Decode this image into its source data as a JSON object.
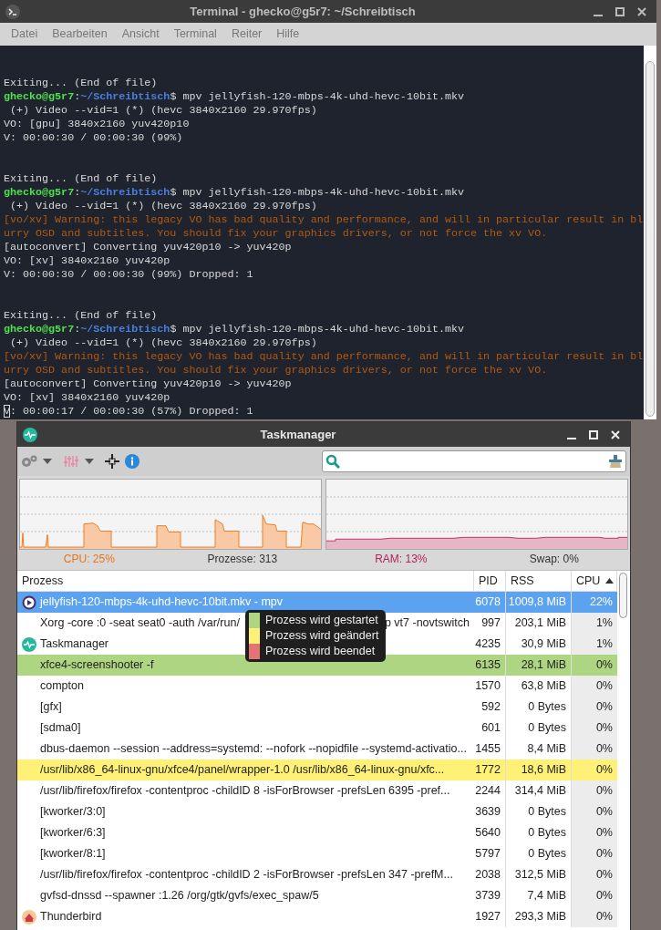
{
  "terminal": {
    "title": "Terminal - ghecko@g5r7: ~/Schreibtisch",
    "menu": [
      "Datei",
      "Bearbeiten",
      "Ansicht",
      "Terminal",
      "Reiter",
      "Hilfe"
    ],
    "lines": [
      {
        "kind": "blank"
      },
      {
        "kind": "blank"
      },
      {
        "kind": "text",
        "segments": [
          {
            "kind": "plain",
            "text": "Exiting... (End of file)"
          }
        ]
      },
      {
        "kind": "text",
        "segments": [
          {
            "kind": "user",
            "text": "ghecko@g5r7"
          },
          {
            "kind": "plain",
            "text": ":"
          },
          {
            "kind": "path",
            "text": "~/Schreibtisch"
          },
          {
            "kind": "plain",
            "text": "$ mpv jellyfish-120-mbps-4k-uhd-hevc-10bit.mkv"
          }
        ]
      },
      {
        "kind": "text",
        "segments": [
          {
            "kind": "plain",
            "text": " (+) Video --vid=1 (*) (hevc 3840x2160 29.970fps)"
          }
        ]
      },
      {
        "kind": "text",
        "segments": [
          {
            "kind": "plain",
            "text": "VO: [gpu] 3840x2160 yuv420p10"
          }
        ]
      },
      {
        "kind": "text",
        "segments": [
          {
            "kind": "plain",
            "text": "V: 00:00:30 / 00:00:30 (99%)"
          }
        ]
      },
      {
        "kind": "blank"
      },
      {
        "kind": "blank"
      },
      {
        "kind": "text",
        "segments": [
          {
            "kind": "plain",
            "text": "Exiting... (End of file)"
          }
        ]
      },
      {
        "kind": "text",
        "segments": [
          {
            "kind": "user",
            "text": "ghecko@g5r7"
          },
          {
            "kind": "plain",
            "text": ":"
          },
          {
            "kind": "path",
            "text": "~/Schreibtisch"
          },
          {
            "kind": "plain",
            "text": "$ mpv jellyfish-120-mbps-4k-uhd-hevc-10bit.mkv"
          }
        ]
      },
      {
        "kind": "text",
        "segments": [
          {
            "kind": "plain",
            "text": " (+) Video --vid=1 (*) (hevc 3840x2160 29.970fps)"
          }
        ]
      },
      {
        "kind": "text",
        "segments": [
          {
            "kind": "warning",
            "text": "[vo/xv] Warning: this legacy VO has bad quality and performance, and will in particular result in bl"
          }
        ]
      },
      {
        "kind": "text",
        "segments": [
          {
            "kind": "warning",
            "text": "urry OSD and subtitles. You should fix your graphics drivers, or not force the xv VO."
          }
        ]
      },
      {
        "kind": "text",
        "segments": [
          {
            "kind": "plain",
            "text": "[autoconvert] Converting yuv420p10 -> yuv420p"
          }
        ]
      },
      {
        "kind": "text",
        "segments": [
          {
            "kind": "plain",
            "text": "VO: [xv] 3840x2160 yuv420p"
          }
        ]
      },
      {
        "kind": "text",
        "segments": [
          {
            "kind": "plain",
            "text": "V: 00:00:30 / 00:00:30 (99%) Dropped: 1"
          }
        ]
      },
      {
        "kind": "blank"
      },
      {
        "kind": "blank"
      },
      {
        "kind": "text",
        "segments": [
          {
            "kind": "plain",
            "text": "Exiting... (End of file)"
          }
        ]
      },
      {
        "kind": "text",
        "segments": [
          {
            "kind": "user",
            "text": "ghecko@g5r7"
          },
          {
            "kind": "plain",
            "text": ":"
          },
          {
            "kind": "path",
            "text": "~/Schreibtisch"
          },
          {
            "kind": "plain",
            "text": "$ mpv jellyfish-120-mbps-4k-uhd-hevc-10bit.mkv"
          }
        ]
      },
      {
        "kind": "text",
        "segments": [
          {
            "kind": "plain",
            "text": " (+) Video --vid=1 (*) (hevc 3840x2160 29.970fps)"
          }
        ]
      },
      {
        "kind": "text",
        "segments": [
          {
            "kind": "warning",
            "text": "[vo/xv] Warning: this legacy VO has bad quality and performance, and will in particular result in bl"
          }
        ]
      },
      {
        "kind": "text",
        "segments": [
          {
            "kind": "warning",
            "text": "urry OSD and subtitles. You should fix your graphics drivers, or not force the xv VO."
          }
        ]
      },
      {
        "kind": "text",
        "segments": [
          {
            "kind": "plain",
            "text": "[autoconvert] Converting yuv420p10 -> yuv420p"
          }
        ]
      },
      {
        "kind": "text",
        "segments": [
          {
            "kind": "plain",
            "text": "VO: [xv] 3840x2160 yuv420p"
          }
        ]
      },
      {
        "kind": "text",
        "segments": [
          {
            "kind": "cursor",
            "text": "V"
          },
          {
            "kind": "plain",
            "text": ": 00:00:17 / 00:00:30 (57%) Dropped: 1"
          }
        ]
      }
    ]
  },
  "taskmanager": {
    "title": "Taskmanager",
    "status": {
      "cpu": "CPU: 25%",
      "processes": "Prozesse: 313",
      "ram": "RAM: 13%",
      "swap": "Swap: 0%"
    },
    "columns": [
      {
        "label": "Prozess",
        "sorted": false
      },
      {
        "label": "PID",
        "sorted": false
      },
      {
        "label": "RSS",
        "sorted": false
      },
      {
        "label": "CPU",
        "sorted": true
      }
    ],
    "rows": [
      {
        "kind": "app",
        "process": "jellyfish-120-mbps-4k-uhd-hevc-10bit.mkv - mpv",
        "pid": "6078",
        "rss": "1009,8 MiB",
        "cpu": "22%",
        "selected": true
      },
      {
        "kind": "plain",
        "process": "Xorg -core :0 -seat seat0 -auth /var/run/",
        "process_tail": "p vt7 -novtswitch",
        "pid": "997",
        "rss": "203,1 MiB",
        "cpu": "1%",
        "selected": false
      },
      {
        "kind": "app",
        "process": "Taskmanager",
        "pid": "4235",
        "rss": "30,9 MiB",
        "cpu": "1%",
        "selected": false
      },
      {
        "kind": "plain",
        "process": "xfce4-screenshooter -f",
        "pid": "6135",
        "rss": "28,1 MiB",
        "cpu": "0%",
        "selected": false,
        "color": "#aed581"
      },
      {
        "kind": "plain",
        "process": "compton",
        "pid": "1570",
        "rss": "63,8 MiB",
        "cpu": "0%",
        "selected": false
      },
      {
        "kind": "plain",
        "process": "[gfx]",
        "pid": "592",
        "rss": "0 Bytes",
        "cpu": "0%",
        "selected": false
      },
      {
        "kind": "plain",
        "process": "[sdma0]",
        "pid": "601",
        "rss": "0 Bytes",
        "cpu": "0%",
        "selected": false
      },
      {
        "kind": "plain",
        "process": "dbus-daemon --session --address=systemd: --nofork --nopidfile --systemd-activatio...",
        "pid": "1455",
        "rss": "8,4 MiB",
        "cpu": "0%",
        "selected": false
      },
      {
        "kind": "plain",
        "process": "/usr/lib/x86_64-linux-gnu/xfce4/panel/wrapper-1.0 /usr/lib/x86_64-linux-gnu/xfc...",
        "pid": "1772",
        "rss": "18,6 MiB",
        "cpu": "0%",
        "selected": false,
        "color": "#fff176"
      },
      {
        "kind": "plain",
        "process": "/usr/lib/firefox/firefox -contentproc -childID 8 -isForBrowser -prefsLen 6395 -pref...",
        "pid": "2244",
        "rss": "314,4 MiB",
        "cpu": "0%",
        "selected": false
      },
      {
        "kind": "plain",
        "process": "[kworker/3:0]",
        "pid": "3639",
        "rss": "0 Bytes",
        "cpu": "0%",
        "selected": false
      },
      {
        "kind": "plain",
        "process": "[kworker/6:3]",
        "pid": "5640",
        "rss": "0 Bytes",
        "cpu": "0%",
        "selected": false
      },
      {
        "kind": "plain",
        "process": "[kworker/8:1]",
        "pid": "5797",
        "rss": "0 Bytes",
        "cpu": "0%",
        "selected": false
      },
      {
        "kind": "plain",
        "process": "/usr/lib/firefox/firefox -contentproc -childID 2 -isForBrowser -prefsLen 347 -prefM...",
        "pid": "2038",
        "rss": "312,5 MiB",
        "cpu": "0%",
        "selected": false
      },
      {
        "kind": "plain",
        "process": "gvfsd-dnssd --spawner :1.26 /org/gtk/gvfs/exec_spaw/5",
        "pid": "3739",
        "rss": "7,4 MiB",
        "cpu": "0%",
        "selected": false
      },
      {
        "kind": "app",
        "process": "Thunderbird",
        "pid": "1927",
        "rss": "293,3 MiB",
        "cpu": "0%",
        "selected": false
      }
    ],
    "legend": [
      {
        "label": "Prozess wird gestartet",
        "color": "#aed581"
      },
      {
        "label": "Prozess wird geändert",
        "color": "#fff176"
      },
      {
        "label": "Prozess wird beendet",
        "color": "#e57373"
      }
    ]
  }
}
